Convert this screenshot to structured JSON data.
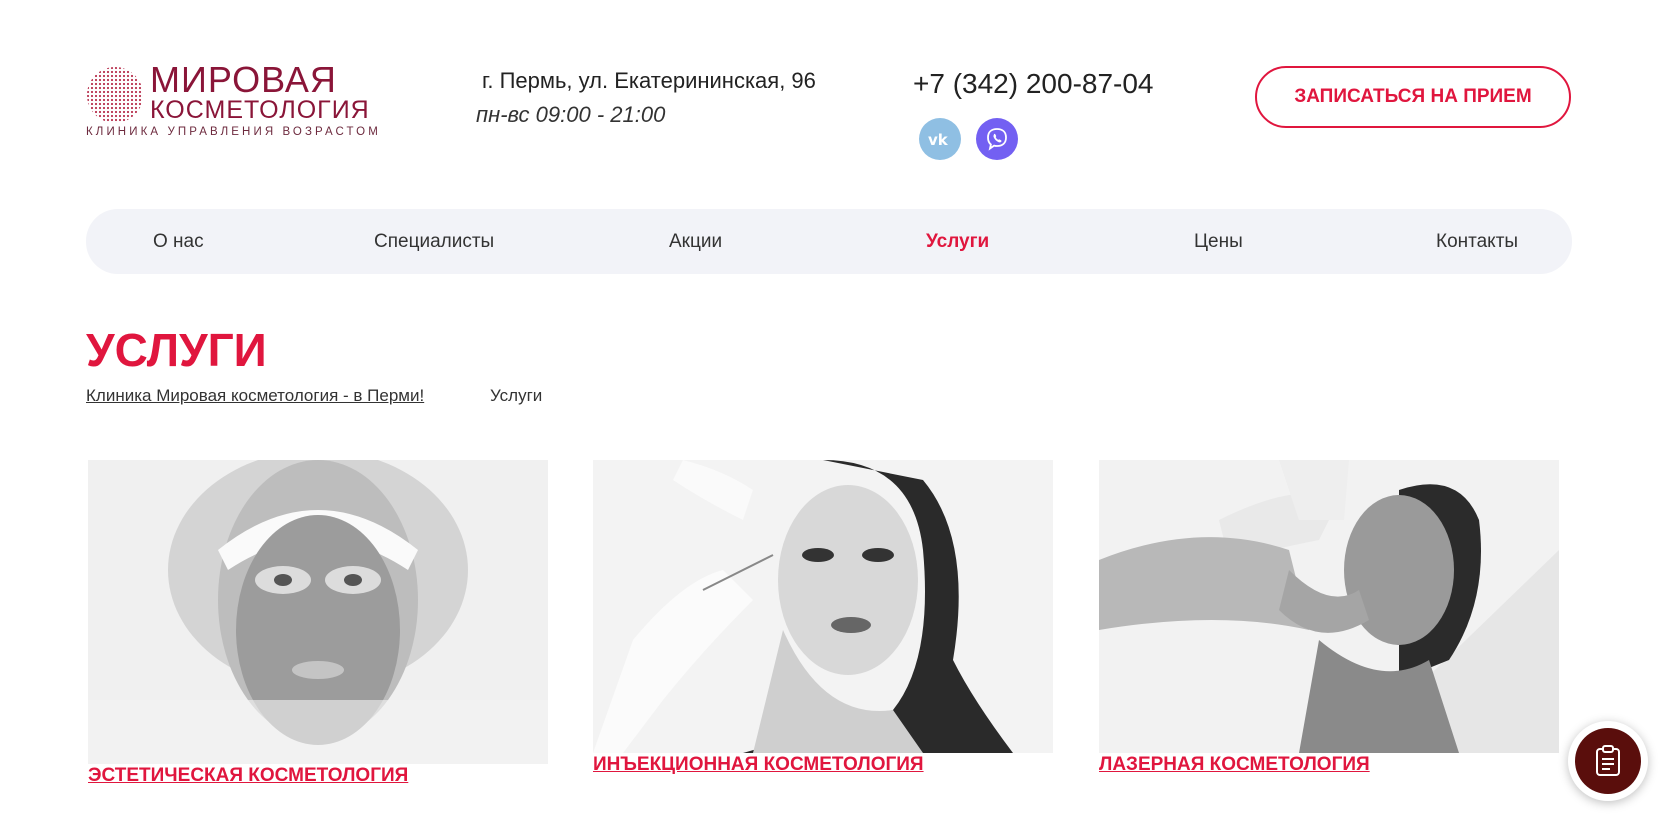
{
  "header": {
    "logo": {
      "line1": "МИРОВАЯ",
      "line2": "КОСМЕТОЛОГИЯ",
      "tagline": "КЛИНИКА УПРАВЛЕНИЯ ВОЗРАСТОМ"
    },
    "address": "г. Пермь, ул. Екатерининская, 96",
    "hours": "пн-вс 09:00 - 21:00",
    "phone": "+7 (342) 200-87-04",
    "social": [
      {
        "name": "vk-icon",
        "label": "VK"
      },
      {
        "name": "viber-icon",
        "label": "Viber"
      }
    ],
    "book_button": "ЗАПИСАТЬСЯ НА ПРИЕМ"
  },
  "nav": {
    "items": [
      {
        "label": "О нас",
        "active": false
      },
      {
        "label": "Специалисты",
        "active": false
      },
      {
        "label": "Акции",
        "active": false
      },
      {
        "label": "Услуги",
        "active": true
      },
      {
        "label": "Цены",
        "active": false
      },
      {
        "label": "Контакты",
        "active": false
      }
    ]
  },
  "page": {
    "title": "УСЛУГИ",
    "breadcrumb": [
      "Клиника Мировая косметология - в Перми!",
      "Услуги"
    ]
  },
  "services": [
    {
      "label": "ЭСТЕТИЧЕСКАЯ КОСМЕТОЛОГИЯ",
      "image": "face-mask-photo"
    },
    {
      "label": "ИНЪЕКЦИОННАЯ КОСМЕТОЛОГИЯ",
      "image": "injection-photo"
    },
    {
      "label": "ЛАЗЕРНАЯ КОСМЕТОЛОГИЯ",
      "image": "laser-photo"
    }
  ],
  "colors": {
    "accent": "#e0163e",
    "brand": "#8a1538",
    "nav_bg": "#f2f3f8",
    "fab": "#5a0e0c"
  }
}
